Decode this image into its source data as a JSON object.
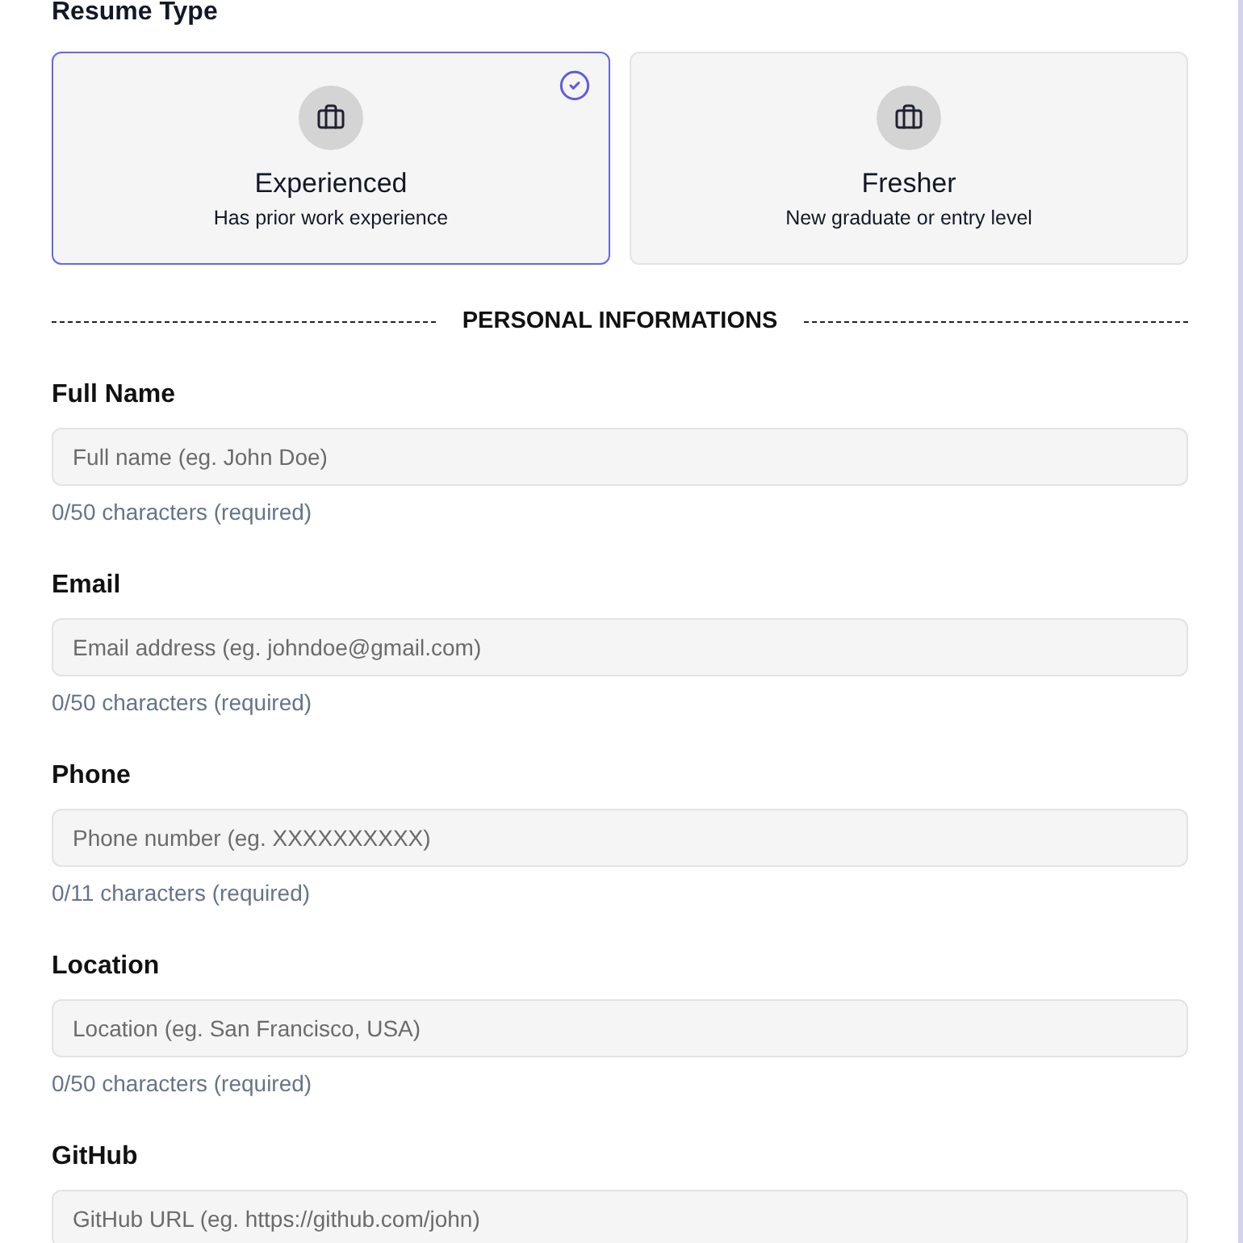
{
  "resume_type": {
    "label": "Resume Type",
    "options": [
      {
        "title": "Experienced",
        "subtitle": "Has prior work experience",
        "selected": true
      },
      {
        "title": "Fresher",
        "subtitle": "New graduate or entry level",
        "selected": false
      }
    ]
  },
  "section": {
    "title": "PERSONAL INFORMATIONS"
  },
  "fields": [
    {
      "label": "Full Name",
      "placeholder": "Full name (eg. John Doe)",
      "hint": "0/50 characters (required)"
    },
    {
      "label": "Email",
      "placeholder": "Email address (eg. johndoe@gmail.com)",
      "hint": "0/50 characters (required)"
    },
    {
      "label": "Phone",
      "placeholder": "Phone number (eg. XXXXXXXXXX)",
      "hint": "0/11 characters (required)"
    },
    {
      "label": "Location",
      "placeholder": "Location (eg. San Francisco, USA)",
      "hint": "0/50 characters (required)"
    },
    {
      "label": "GitHub",
      "placeholder": "GitHub URL (eg. https://github.com/john)"
    }
  ]
}
